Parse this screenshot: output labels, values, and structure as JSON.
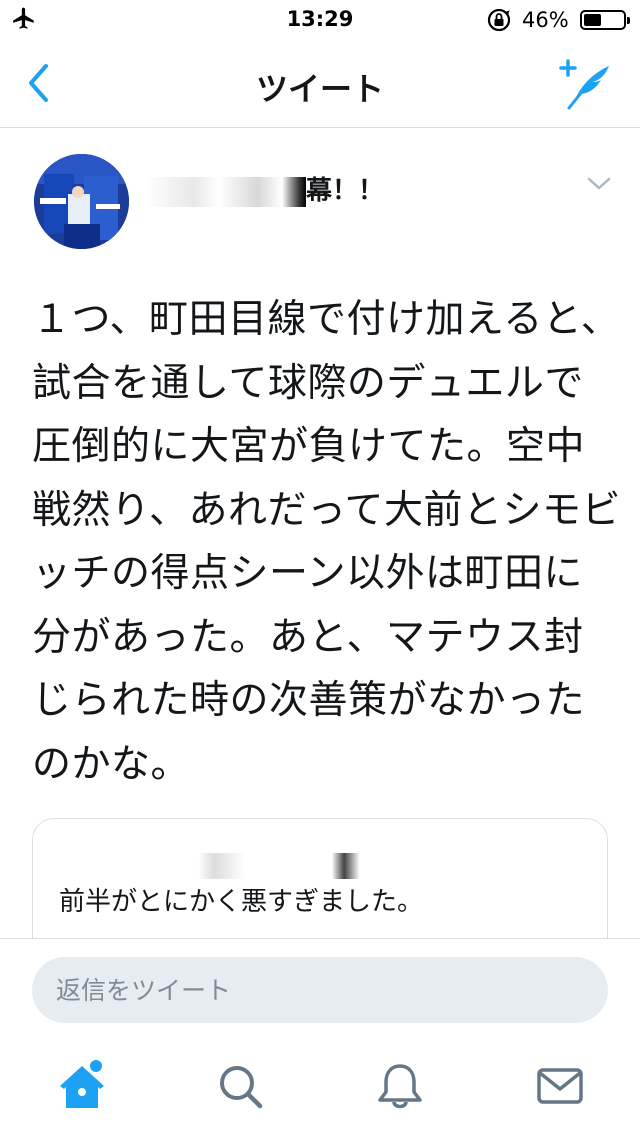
{
  "status_bar": {
    "time": "13:29",
    "battery_percent": "46%",
    "battery_level": 0.46,
    "airplane_mode": true,
    "orientation_lock": true
  },
  "nav": {
    "title": "ツイート",
    "back_icon": "chevron-left-icon",
    "compose_icon": "compose-tweet-icon"
  },
  "tweet": {
    "author_name_visible": "幕！！",
    "body": "１つ、町田目線で付け加えると、試合を通して球際のデュエルで圧倒的に大宮が負けてた。空中戦然り、あれだって大前とシモビッチの得点シーン以外は町田に分があった。あと、マテウス封じられた時の次善策がなかったのかな。"
  },
  "quoted_tweet": {
    "text": "前半がとにかく悪すぎました。"
  },
  "reply": {
    "placeholder": "返信をツイート"
  },
  "tabs": [
    {
      "name": "home",
      "icon": "home-icon",
      "active": true,
      "has_notification_dot": true
    },
    {
      "name": "search",
      "icon": "search-icon",
      "active": false
    },
    {
      "name": "notifications",
      "icon": "bell-icon",
      "active": false
    },
    {
      "name": "messages",
      "icon": "mail-icon",
      "active": false
    }
  ],
  "colors": {
    "accent": "#1da1f2",
    "icon_gray": "#657786",
    "text": "#14171a",
    "divider": "#dadee2",
    "input_bg": "#e6ecf0"
  }
}
